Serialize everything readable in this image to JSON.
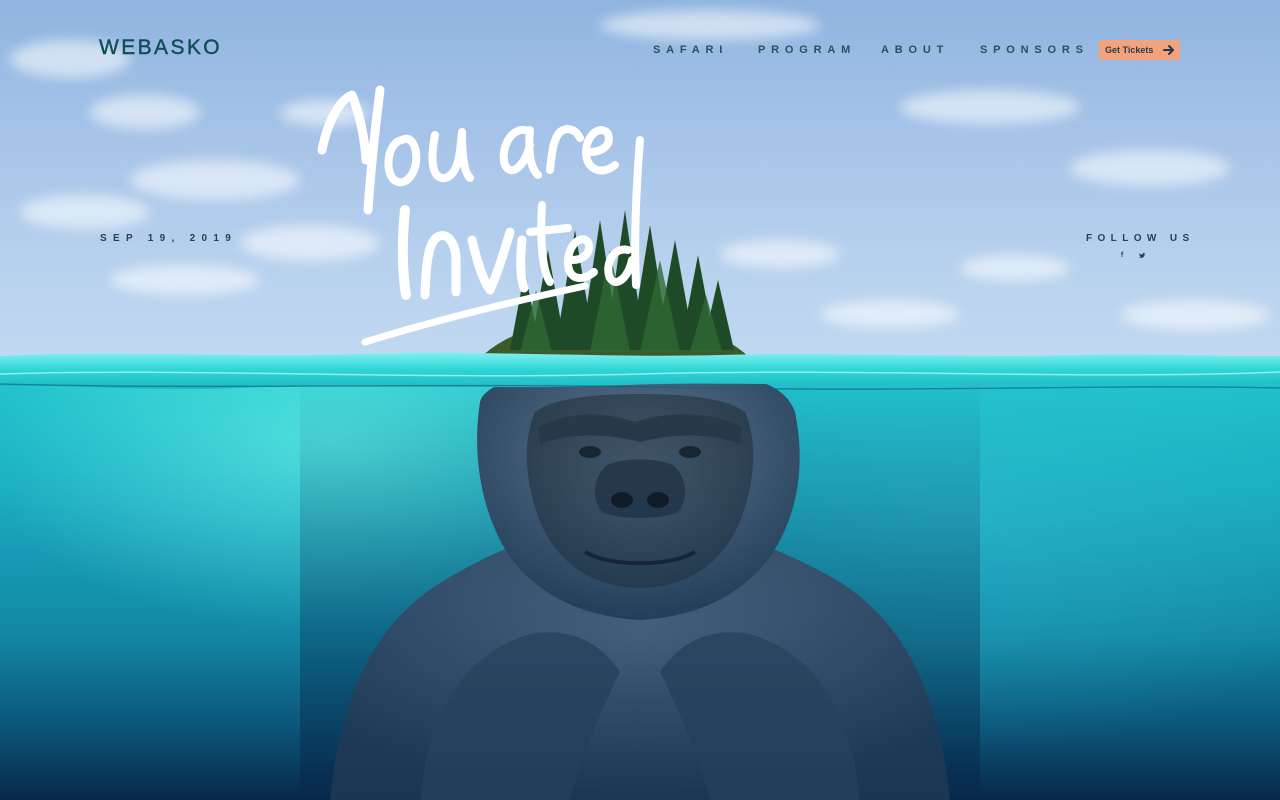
{
  "brand": {
    "logo_text": "WEBASKO",
    "logo_color": "#0f4e55"
  },
  "nav": {
    "items": [
      {
        "label": "SAFARI"
      },
      {
        "label": "PROGRAM"
      },
      {
        "label": "ABOUT"
      },
      {
        "label": "SPONSORS"
      }
    ],
    "cta_label": "Get Tickets",
    "cta_icon": "arrow-right-icon",
    "cta_color": "#f2a27c"
  },
  "hero": {
    "headline": "You are invited",
    "event_date": "SEP 19, 2019",
    "scene": "island-above-water-gorilla-below"
  },
  "social": {
    "heading": "FOLLOW US",
    "icons": [
      {
        "name": "facebook-icon",
        "glyph": "f"
      },
      {
        "name": "twitter-icon",
        "glyph": "t"
      }
    ]
  },
  "colors": {
    "sky": "#a5c3e8",
    "water": "#1fc4cc",
    "deep_water": "#07284a",
    "text_dark": "#28525c"
  }
}
